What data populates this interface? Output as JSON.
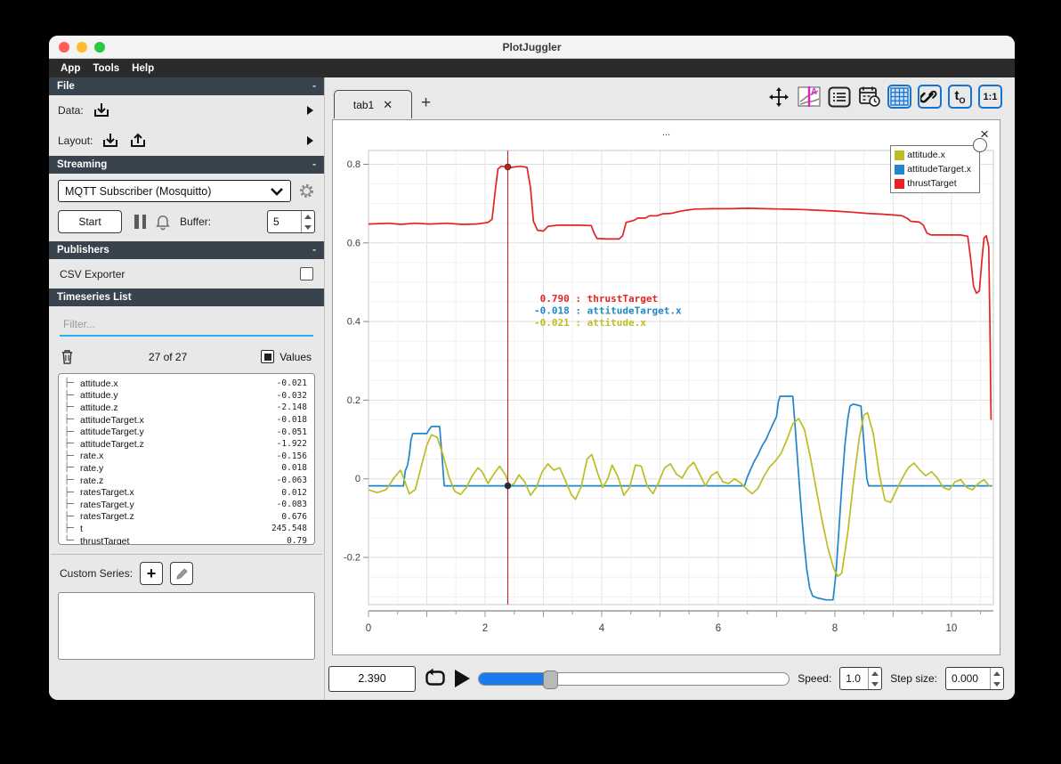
{
  "window": {
    "title": "PlotJuggler"
  },
  "menu": {
    "items": [
      "App",
      "Tools",
      "Help"
    ]
  },
  "sidebar": {
    "file_section": {
      "title": "File",
      "collapse": "-",
      "data_label": "Data:",
      "layout_label": "Layout:"
    },
    "streaming_section": {
      "title": "Streaming",
      "collapse": "-",
      "source": "MQTT Subscriber (Mosquitto)",
      "start_label": "Start",
      "buffer_label": "Buffer:",
      "buffer_value": "5"
    },
    "publishers_section": {
      "title": "Publishers",
      "collapse": "-",
      "csv_label": "CSV Exporter"
    },
    "timeseries_section": {
      "title": "Timeseries List",
      "collapse": "-",
      "filter_placeholder": "Filter...",
      "count_text": "27 of 27",
      "values_label": "Values",
      "items": [
        {
          "name": "attitude.x",
          "value": "-0.021"
        },
        {
          "name": "attitude.y",
          "value": "-0.032"
        },
        {
          "name": "attitude.z",
          "value": "-2.148"
        },
        {
          "name": "attitudeTarget.x",
          "value": "-0.018"
        },
        {
          "name": "attitudeTarget.y",
          "value": "-0.051"
        },
        {
          "name": "attitudeTarget.z",
          "value": "-1.922"
        },
        {
          "name": "rate.x",
          "value": "-0.156"
        },
        {
          "name": "rate.y",
          "value": "0.018"
        },
        {
          "name": "rate.z",
          "value": "-0.063"
        },
        {
          "name": "ratesTarget.x",
          "value": "0.012"
        },
        {
          "name": "ratesTarget.y",
          "value": "-0.083"
        },
        {
          "name": "ratesTarget.z",
          "value": "0.676"
        },
        {
          "name": "t",
          "value": "245.548"
        },
        {
          "name": "thrustTarget",
          "value": "0.79"
        }
      ],
      "custom_series_label": "Custom Series:"
    }
  },
  "tabs": {
    "active_label": "tab1",
    "add_label": "+"
  },
  "toolbar": {
    "t_zero": "t",
    "t_zero_sub": "O",
    "ratio": "1:1"
  },
  "plot": {
    "title": "...",
    "close": "×",
    "legend": [
      {
        "label": "attitude.x",
        "color": "#bcbd22"
      },
      {
        "label": "attitudeTarget.x",
        "color": "#1f87c9"
      },
      {
        "label": "thrustTarget",
        "color": "#e62222"
      }
    ],
    "tooltip": {
      "anchor_t": 2.84,
      "anchor_v": 0.45,
      "lines": [
        {
          "text": " 0.790 : thrustTarget",
          "color": "#e62222"
        },
        {
          "text": "-0.018 : attitudeTarget.x",
          "color": "#1f87c9"
        },
        {
          "text": "-0.021 : attitude.x",
          "color": "#bcbd22"
        }
      ]
    },
    "tracker": {
      "time": 2.39,
      "color": "#cc2222",
      "dots": [
        {
          "v": 0.793,
          "color": "#d01818"
        },
        {
          "v": -0.018,
          "color": "#1b2e4a"
        }
      ]
    }
  },
  "chart_data": {
    "type": "line",
    "title": "...",
    "xlabel": "",
    "ylabel": "",
    "xlim": [
      0,
      10.72
    ],
    "ylim": [
      -0.32,
      0.835
    ],
    "x_major_ticks": [
      0,
      2,
      4,
      6,
      8,
      10
    ],
    "y_major_ticks": [
      -0.2,
      0,
      0.2,
      0.4,
      0.6,
      0.8
    ],
    "grid": true,
    "legend_position": "top-right",
    "series": [
      {
        "name": "thrustTarget",
        "color": "#e62222",
        "points": [
          [
            0,
            0.648
          ],
          [
            0.35,
            0.65
          ],
          [
            0.55,
            0.647
          ],
          [
            0.8,
            0.65
          ],
          [
            1.05,
            0.648
          ],
          [
            1.35,
            0.65
          ],
          [
            1.6,
            0.647
          ],
          [
            1.85,
            0.648
          ],
          [
            2.05,
            0.652
          ],
          [
            2.12,
            0.66
          ],
          [
            2.18,
            0.74
          ],
          [
            2.22,
            0.788
          ],
          [
            2.28,
            0.795
          ],
          [
            2.45,
            0.792
          ],
          [
            2.6,
            0.795
          ],
          [
            2.72,
            0.792
          ],
          [
            2.78,
            0.74
          ],
          [
            2.83,
            0.655
          ],
          [
            2.9,
            0.632
          ],
          [
            3.0,
            0.63
          ],
          [
            3.08,
            0.642
          ],
          [
            3.25,
            0.645
          ],
          [
            3.6,
            0.645
          ],
          [
            3.82,
            0.644
          ],
          [
            3.87,
            0.625
          ],
          [
            3.92,
            0.611
          ],
          [
            4.1,
            0.61
          ],
          [
            4.3,
            0.61
          ],
          [
            4.36,
            0.618
          ],
          [
            4.42,
            0.652
          ],
          [
            4.55,
            0.657
          ],
          [
            4.62,
            0.663
          ],
          [
            4.75,
            0.663
          ],
          [
            4.82,
            0.669
          ],
          [
            4.95,
            0.669
          ],
          [
            5.05,
            0.674
          ],
          [
            5.2,
            0.675
          ],
          [
            5.3,
            0.679
          ],
          [
            5.45,
            0.683
          ],
          [
            5.6,
            0.686
          ],
          [
            5.9,
            0.687
          ],
          [
            6.2,
            0.687
          ],
          [
            6.5,
            0.688
          ],
          [
            6.8,
            0.687
          ],
          [
            7.1,
            0.686
          ],
          [
            7.4,
            0.685
          ],
          [
            7.7,
            0.683
          ],
          [
            8.0,
            0.681
          ],
          [
            8.3,
            0.678
          ],
          [
            8.55,
            0.675
          ],
          [
            8.8,
            0.673
          ],
          [
            9.0,
            0.671
          ],
          [
            9.15,
            0.669
          ],
          [
            9.25,
            0.662
          ],
          [
            9.3,
            0.655
          ],
          [
            9.45,
            0.653
          ],
          [
            9.52,
            0.645
          ],
          [
            9.58,
            0.625
          ],
          [
            9.65,
            0.62
          ],
          [
            9.9,
            0.62
          ],
          [
            10.15,
            0.62
          ],
          [
            10.28,
            0.617
          ],
          [
            10.33,
            0.56
          ],
          [
            10.38,
            0.49
          ],
          [
            10.43,
            0.472
          ],
          [
            10.48,
            0.478
          ],
          [
            10.52,
            0.55
          ],
          [
            10.56,
            0.612
          ],
          [
            10.6,
            0.618
          ],
          [
            10.64,
            0.59
          ],
          [
            10.66,
            0.4
          ],
          [
            10.68,
            0.15
          ]
        ]
      },
      {
        "name": "attitudeTarget.x",
        "color": "#1f87c9",
        "points": [
          [
            0,
            -0.018
          ],
          [
            0.6,
            -0.018
          ],
          [
            0.63,
            0.02
          ],
          [
            0.67,
            0.035
          ],
          [
            0.7,
            0.06
          ],
          [
            0.73,
            0.1
          ],
          [
            0.76,
            0.115
          ],
          [
            1.0,
            0.115
          ],
          [
            1.04,
            0.125
          ],
          [
            1.08,
            0.133
          ],
          [
            1.22,
            0.133
          ],
          [
            1.26,
            0.06
          ],
          [
            1.3,
            -0.018
          ],
          [
            2.5,
            -0.018
          ],
          [
            4.0,
            -0.018
          ],
          [
            5.5,
            -0.018
          ],
          [
            6.45,
            -0.018
          ],
          [
            6.5,
            0.005
          ],
          [
            6.55,
            0.022
          ],
          [
            6.62,
            0.045
          ],
          [
            6.68,
            0.06
          ],
          [
            6.75,
            0.083
          ],
          [
            6.82,
            0.1
          ],
          [
            6.88,
            0.12
          ],
          [
            6.94,
            0.14
          ],
          [
            7.0,
            0.158
          ],
          [
            7.03,
            0.195
          ],
          [
            7.06,
            0.21
          ],
          [
            7.28,
            0.21
          ],
          [
            7.32,
            0.13
          ],
          [
            7.37,
            0.03
          ],
          [
            7.42,
            -0.07
          ],
          [
            7.47,
            -0.16
          ],
          [
            7.52,
            -0.23
          ],
          [
            7.57,
            -0.278
          ],
          [
            7.62,
            -0.298
          ],
          [
            7.7,
            -0.303
          ],
          [
            7.85,
            -0.308
          ],
          [
            7.97,
            -0.308
          ],
          [
            8.02,
            -0.24
          ],
          [
            8.07,
            -0.13
          ],
          [
            8.12,
            -0.02
          ],
          [
            8.17,
            0.08
          ],
          [
            8.22,
            0.15
          ],
          [
            8.26,
            0.185
          ],
          [
            8.32,
            0.19
          ],
          [
            8.45,
            0.185
          ],
          [
            8.5,
            0.09
          ],
          [
            8.55,
            0.0
          ],
          [
            8.58,
            -0.018
          ],
          [
            9.5,
            -0.018
          ],
          [
            10.7,
            -0.018
          ]
        ]
      },
      {
        "name": "attitude.x",
        "color": "#bcbd22",
        "points": [
          [
            0,
            -0.028
          ],
          [
            0.15,
            -0.035
          ],
          [
            0.3,
            -0.028
          ],
          [
            0.45,
            0.005
          ],
          [
            0.55,
            0.022
          ],
          [
            0.62,
            -0.005
          ],
          [
            0.7,
            -0.038
          ],
          [
            0.8,
            -0.028
          ],
          [
            0.9,
            0.028
          ],
          [
            1.0,
            0.085
          ],
          [
            1.08,
            0.112
          ],
          [
            1.18,
            0.105
          ],
          [
            1.28,
            0.06
          ],
          [
            1.38,
            0.005
          ],
          [
            1.48,
            -0.032
          ],
          [
            1.58,
            -0.04
          ],
          [
            1.68,
            -0.022
          ],
          [
            1.78,
            0.008
          ],
          [
            1.88,
            0.028
          ],
          [
            1.95,
            0.018
          ],
          [
            2.05,
            -0.012
          ],
          [
            2.15,
            0.012
          ],
          [
            2.25,
            0.032
          ],
          [
            2.35,
            0.01
          ],
          [
            2.42,
            -0.018
          ],
          [
            2.5,
            -0.012
          ],
          [
            2.58,
            0.01
          ],
          [
            2.68,
            -0.008
          ],
          [
            2.78,
            -0.042
          ],
          [
            2.88,
            -0.022
          ],
          [
            2.98,
            0.018
          ],
          [
            3.08,
            0.038
          ],
          [
            3.18,
            0.022
          ],
          [
            3.28,
            0.028
          ],
          [
            3.38,
            -0.005
          ],
          [
            3.48,
            -0.04
          ],
          [
            3.55,
            -0.052
          ],
          [
            3.65,
            -0.02
          ],
          [
            3.75,
            0.05
          ],
          [
            3.83,
            0.062
          ],
          [
            3.93,
            0.015
          ],
          [
            4.02,
            -0.022
          ],
          [
            4.1,
            -0.002
          ],
          [
            4.18,
            0.035
          ],
          [
            4.28,
            0.005
          ],
          [
            4.38,
            -0.042
          ],
          [
            4.48,
            -0.022
          ],
          [
            4.58,
            0.035
          ],
          [
            4.68,
            0.032
          ],
          [
            4.78,
            -0.018
          ],
          [
            4.88,
            -0.038
          ],
          [
            4.98,
            -0.008
          ],
          [
            5.08,
            0.028
          ],
          [
            5.18,
            0.038
          ],
          [
            5.28,
            0.012
          ],
          [
            5.38,
            0.002
          ],
          [
            5.48,
            0.028
          ],
          [
            5.58,
            0.042
          ],
          [
            5.68,
            0.012
          ],
          [
            5.78,
            -0.018
          ],
          [
            5.88,
            0.008
          ],
          [
            5.98,
            0.018
          ],
          [
            6.08,
            -0.008
          ],
          [
            6.18,
            -0.012
          ],
          [
            6.28,
            0.0
          ],
          [
            6.38,
            -0.01
          ],
          [
            6.48,
            -0.025
          ],
          [
            6.58,
            -0.038
          ],
          [
            6.68,
            -0.025
          ],
          [
            6.78,
            0.005
          ],
          [
            6.88,
            0.03
          ],
          [
            6.98,
            0.045
          ],
          [
            7.08,
            0.065
          ],
          [
            7.18,
            0.1
          ],
          [
            7.28,
            0.14
          ],
          [
            7.38,
            0.153
          ],
          [
            7.48,
            0.125
          ],
          [
            7.58,
            0.055
          ],
          [
            7.68,
            -0.025
          ],
          [
            7.78,
            -0.105
          ],
          [
            7.88,
            -0.175
          ],
          [
            7.98,
            -0.228
          ],
          [
            8.05,
            -0.248
          ],
          [
            8.12,
            -0.24
          ],
          [
            8.22,
            -0.14
          ],
          [
            8.32,
            -0.01
          ],
          [
            8.42,
            0.105
          ],
          [
            8.5,
            0.162
          ],
          [
            8.56,
            0.168
          ],
          [
            8.66,
            0.115
          ],
          [
            8.76,
            0.015
          ],
          [
            8.86,
            -0.055
          ],
          [
            8.96,
            -0.06
          ],
          [
            9.06,
            -0.028
          ],
          [
            9.16,
            0.002
          ],
          [
            9.26,
            0.028
          ],
          [
            9.36,
            0.04
          ],
          [
            9.46,
            0.022
          ],
          [
            9.56,
            0.008
          ],
          [
            9.66,
            0.018
          ],
          [
            9.76,
            0.002
          ],
          [
            9.86,
            -0.022
          ],
          [
            9.96,
            -0.028
          ],
          [
            10.06,
            -0.008
          ],
          [
            10.16,
            -0.002
          ],
          [
            10.26,
            -0.022
          ],
          [
            10.36,
            -0.028
          ],
          [
            10.46,
            -0.012
          ],
          [
            10.56,
            -0.002
          ],
          [
            10.66,
            -0.02
          ]
        ]
      }
    ]
  },
  "controls": {
    "time": "2.390",
    "speed_label": "Speed:",
    "speed_value": "1.0",
    "step_label": "Step size:",
    "step_value": "0.000"
  }
}
